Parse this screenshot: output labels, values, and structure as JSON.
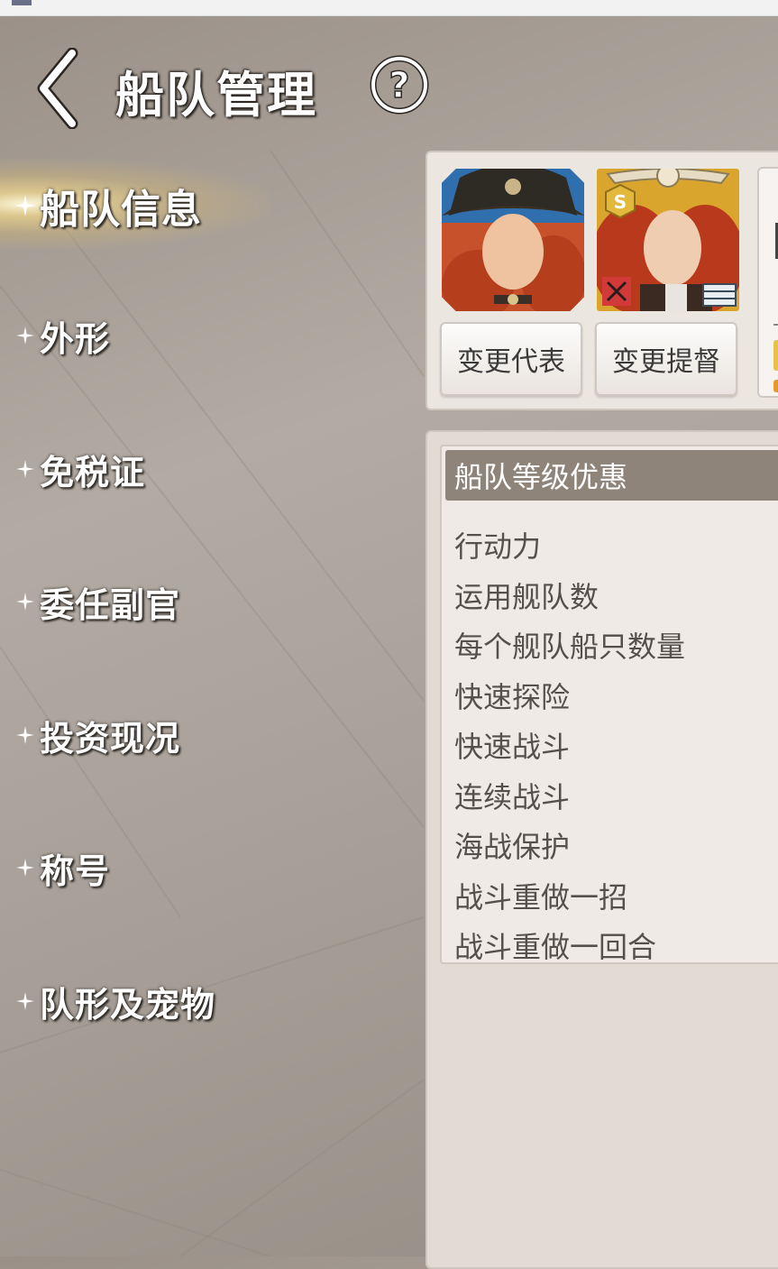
{
  "header": {
    "title": "船队管理"
  },
  "sidebar": {
    "items": [
      {
        "label": "船队信息",
        "active": true
      },
      {
        "label": "外形"
      },
      {
        "label": "免税证"
      },
      {
        "label": "委任副官"
      },
      {
        "label": "投资现况"
      },
      {
        "label": "称号"
      },
      {
        "label": "队形及宠物"
      }
    ]
  },
  "top_panel": {
    "portrait_1": "fleet-representative-portrait",
    "portrait_2": "admiral-portrait",
    "admiral_grade": "S",
    "change_rep_label": "变更代表",
    "change_admiral_label": "变更提督"
  },
  "perks": {
    "header": "船队等级优惠",
    "items": [
      "行动力",
      "运用舰队数",
      "每个舰队船只数量",
      "快速探险",
      "快速战斗",
      "连续战斗",
      "海战保护",
      "战斗重做一招",
      "战斗重做一回合"
    ]
  },
  "colors": {
    "title_text": "#ffffff",
    "panel_bg": "#ece6e0",
    "header_row": "#8f8479"
  }
}
